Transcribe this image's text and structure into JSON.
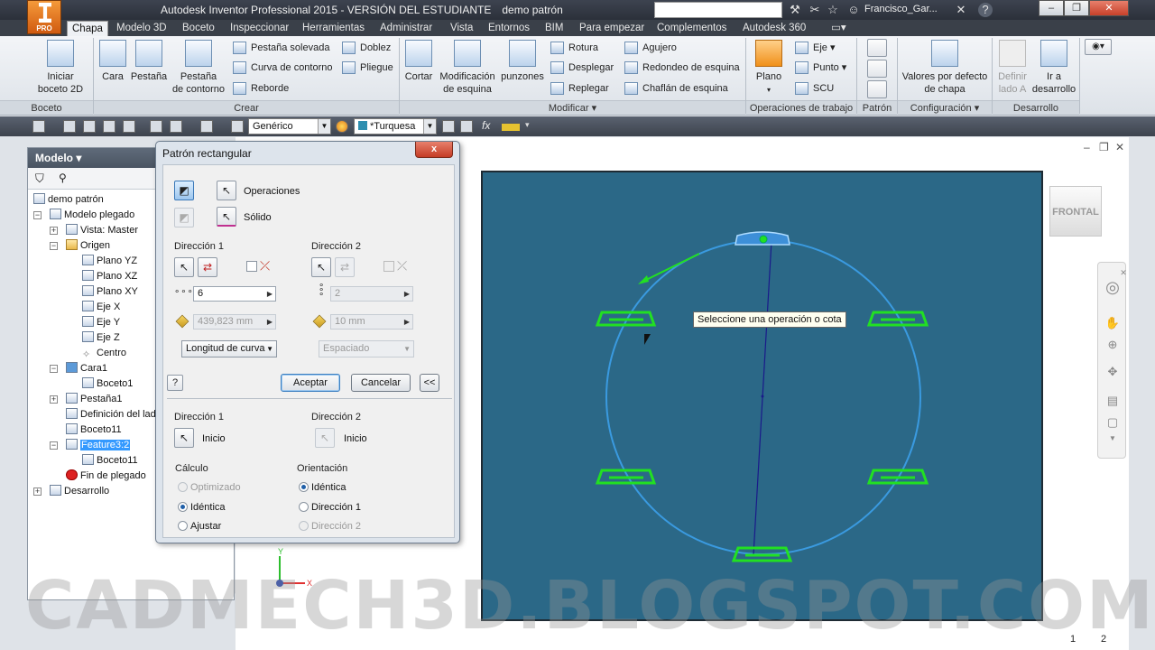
{
  "titlebar": {
    "app_badge": "PRO",
    "title": "Autodesk Inventor Professional 2015 - VERSIÓN DEL ESTUDIANTE",
    "document": "demo patrón",
    "user": "Francisco_Gar...",
    "help": "?"
  },
  "tabs": [
    "Chapa",
    "Modelo 3D",
    "Boceto",
    "Inspeccionar",
    "Herramientas",
    "Administrar",
    "Vista",
    "Entornos",
    "BIM",
    "Para empezar",
    "Complementos",
    "Autodesk 360"
  ],
  "ribbon": {
    "boceto": {
      "label": "Boceto",
      "start": "Iniciar",
      "start2": "boceto 2D"
    },
    "crear": {
      "label": "Crear",
      "cara": "Cara",
      "pestana": "Pestaña",
      "pestana_contorno": "Pestaña",
      "pestana_contorno2": "de contorno",
      "pestana_solevada": "Pestaña solevada",
      "curva_contorno": "Curva de contorno",
      "reborde": "Reborde",
      "doblez": "Doblez",
      "pliegue": "Pliegue"
    },
    "modificar": {
      "label": "Modificar",
      "cortar": "Cortar",
      "mod_esquina": "Modificación",
      "mod_esquina2": "de esquina",
      "punzones": "punzones",
      "rotura": "Rotura",
      "desplegar": "Desplegar",
      "replegar": "Replegar",
      "agujero": "Agujero",
      "redondeo": "Redondeo de esquina",
      "chaflan": "Chaflán de esquina"
    },
    "operaciones": {
      "label": "Operaciones de trabajo",
      "plano": "Plano",
      "eje": "Eje",
      "punto": "Punto",
      "scu": "SCU"
    },
    "patron": {
      "label": "Patrón"
    },
    "configuracion": {
      "label": "Configuración",
      "valores": "Valores por defecto",
      "valores2": "de chapa"
    },
    "desarrollo": {
      "label": "Desarrollo",
      "definir": "Definir",
      "definir2": "lado A",
      "ir": "Ir a",
      "ir2": "desarrollo"
    }
  },
  "qat": {
    "material": "Genérico",
    "color": "*Turquesa",
    "fx": "fx"
  },
  "browser": {
    "title": "Modelo",
    "items": [
      "demo patrón",
      "Modelo plegado",
      "Vista: Master",
      "Origen",
      "Plano YZ",
      "Plano XZ",
      "Plano XY",
      "Eje X",
      "Eje Y",
      "Eje Z",
      "Centro",
      "Cara1",
      "Boceto1",
      "Pestaña1",
      "Definición del lado",
      "Boceto11",
      "Feature3:2",
      "Boceto11",
      "Fin de plegado",
      "Desarrollo"
    ]
  },
  "dialog": {
    "title": "Patrón rectangular",
    "close": "x",
    "operaciones": "Operaciones",
    "solido": "Sólido",
    "dir1": {
      "label": "Dirección 1",
      "count": "6",
      "distance": "439,823 mm",
      "method": "Longitud de curva"
    },
    "dir2": {
      "label": "Dirección 2",
      "count": "2",
      "distance": "10 mm",
      "method": "Espaciado"
    },
    "help": "?",
    "accept": "Aceptar",
    "cancel": "Cancelar",
    "more": "<<",
    "start1": {
      "label": "Dirección 1",
      "value": "Inicio"
    },
    "start2": {
      "label": "Dirección 2",
      "value": "Inicio"
    },
    "calculo": {
      "label": "Cálculo",
      "opt1": "Optimizado",
      "opt2": "Idéntica",
      "opt3": "Ajustar"
    },
    "orientacion": {
      "label": "Orientación",
      "opt1": "Idéntica",
      "opt2": "Dirección 1",
      "opt3": "Dirección 2"
    }
  },
  "viewport": {
    "viewcube": "FRONTAL",
    "tooltip": "Seleccione una operación o cota",
    "axis_y": "Y",
    "axis_x": "X",
    "page1": "1",
    "page2": "2"
  },
  "watermark": "CADMECH3D.BLOGSPOT.COM",
  "colors": {
    "canvas": "#2b6887",
    "circle": "#3a9ae0",
    "feature": "#22e022",
    "path": "#1a1a8a"
  }
}
